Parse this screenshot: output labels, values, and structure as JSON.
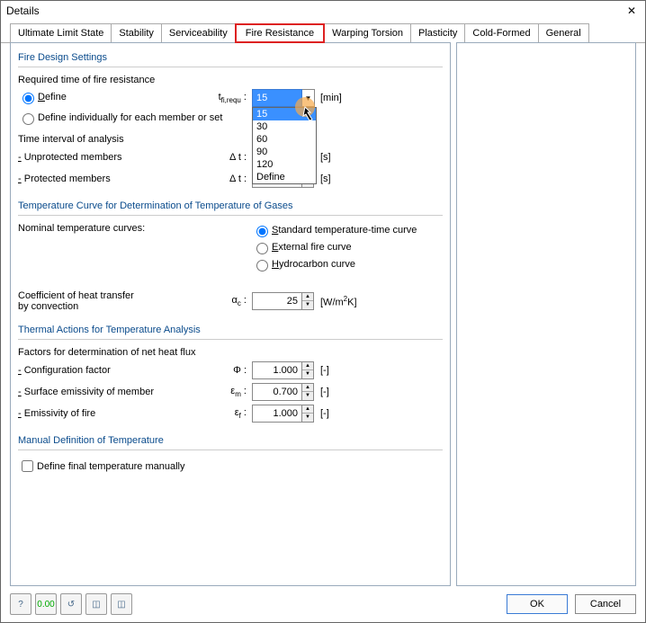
{
  "window": {
    "title": "Details",
    "close": "✕"
  },
  "tabs": [
    "Ultimate Limit State",
    "Stability",
    "Serviceability",
    "Fire Resistance",
    "Warping Torsion",
    "Plasticity",
    "Cold-Formed",
    "General"
  ],
  "active_tab": "Fire Resistance",
  "group1": {
    "title": "Fire Design Settings",
    "required_label": "Required time of fire resistance",
    "opt_define": "Define",
    "opt_individual": "Define individually for each member or set",
    "t_sym_pre": "t",
    "t_sym_sub": "fi,requ",
    "t_colon": " :",
    "t_value": "15",
    "t_unit": "[min]",
    "dropdown_items": [
      "15",
      "30",
      "60",
      "90",
      "120",
      "Define"
    ],
    "time_interval_label": "Time interval of analysis",
    "unprot_label": "- Unprotected members",
    "prot_label": "- Protected members",
    "dt_sym": "Δ t :",
    "dt_un_val": "",
    "dt_pr_val": "",
    "dt_unit": "[s]"
  },
  "group2": {
    "title": "Temperature Curve for Determination of Temperature of Gases",
    "nom_label": "Nominal temperature curves:",
    "opt_std": "Standard temperature-time curve",
    "opt_ext": "External fire curve",
    "opt_hydro": "Hydrocarbon curve",
    "coeff_label1": "Coefficient of heat transfer",
    "coeff_label2": "by convection",
    "ac_sym": "α",
    "ac_sub": "c",
    "ac_colon": " :",
    "ac_val": "25",
    "ac_unit_a": "[W/m",
    "ac_unit_b": "K]"
  },
  "group3": {
    "title": "Thermal Actions for Temperature Analysis",
    "factors_label": "Factors for determination of net heat flux",
    "cfg_label": "- Configuration factor",
    "cfg_sym": "Φ :",
    "cfg_val": "1.000",
    "emis_m_label": "- Surface emissivity of member",
    "em_sym": "ε",
    "em_sub": "m",
    "em_colon": " :",
    "emis_m_val": "0.700",
    "emis_f_label": "- Emissivity of fire",
    "ef_sym": "ε",
    "ef_sub": "f",
    "ef_colon": " :",
    "emis_f_val": "1.000",
    "unit": "[-]"
  },
  "group4": {
    "title": "Manual Definition of Temperature",
    "chk_label": "Define final temperature manually"
  },
  "buttons": {
    "ok": "OK",
    "cancel": "Cancel"
  }
}
